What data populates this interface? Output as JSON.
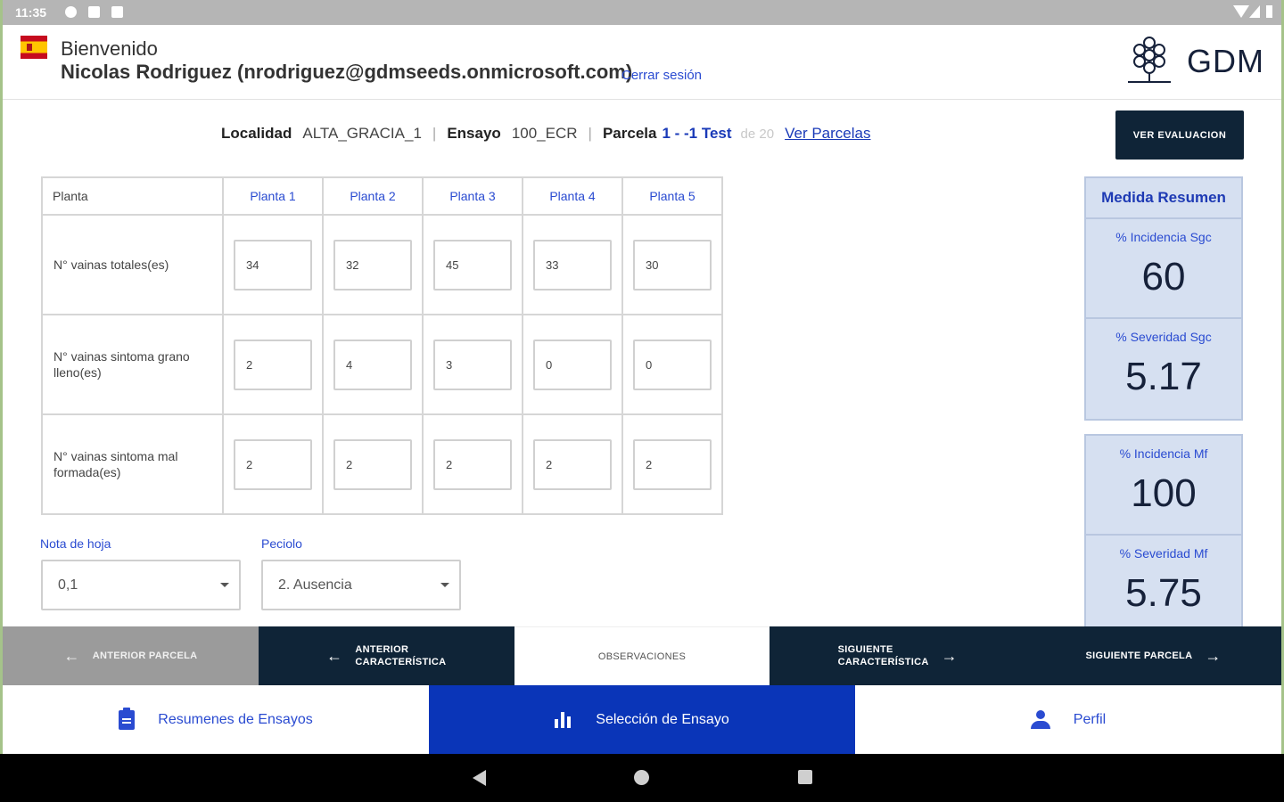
{
  "status_bar": {
    "time": "11:35"
  },
  "header": {
    "welcome": "Bienvenido",
    "user": "Nicolas Rodriguez (nrodriguez@gdmseeds.onmicrosoft.com)",
    "logout": "Cerrar sesión",
    "brand": "GDM"
  },
  "info": {
    "locality_label": "Localidad",
    "locality_value": "ALTA_GRACIA_1",
    "trial_label": "Ensayo",
    "trial_value": "100_ECR",
    "plot_label": "Parcela",
    "plot_value": "1 - -1 Test",
    "plot_total": "de 20",
    "plots_link": "Ver Parcelas",
    "eval_button": "VER EVALUACION"
  },
  "table": {
    "corner": "Planta",
    "columns": [
      "Planta 1",
      "Planta 2",
      "Planta 3",
      "Planta 4",
      "Planta 5"
    ],
    "rows": [
      {
        "label": "N° vainas totales(es)",
        "values": [
          "34",
          "32",
          "45",
          "33",
          "30"
        ]
      },
      {
        "label": "N° vainas sintoma grano lleno(es)",
        "values": [
          "2",
          "4",
          "3",
          "0",
          "0"
        ]
      },
      {
        "label": "N° vainas sintoma mal formada(es)",
        "values": [
          "2",
          "2",
          "2",
          "2",
          "2"
        ]
      }
    ]
  },
  "fields": {
    "leaf_label": "Nota de hoja",
    "leaf_value": "0,1",
    "petiole_label": "Peciolo",
    "petiole_value": "2. Ausencia"
  },
  "summary": {
    "title": "Medida Resumen",
    "items": [
      {
        "label": "% Incidencia Sgc",
        "value": "60"
      },
      {
        "label": "% Severidad Sgc",
        "value": "5.17"
      },
      {
        "label": "% Incidencia Mf",
        "value": "100"
      },
      {
        "label": "% Severidad Mf",
        "value": "5.75"
      }
    ]
  },
  "actions": {
    "prev_plot": "ANTERIOR PARCELA",
    "prev_char_1": "ANTERIOR",
    "prev_char_2": "CARACTERÍSTICA",
    "observations": "OBSERVACIONES",
    "next_char_1": "SIGUIENTE",
    "next_char_2": "CARACTERÍSTICA",
    "next_plot": "SIGUIENTE PARCELA"
  },
  "bottom_nav": {
    "summaries": "Resumenes de Ensayos",
    "selection": "Selección de Ensayo",
    "profile": "Perfil"
  },
  "colors": {
    "primary_dark": "#0f2437",
    "accent_blue": "#0a35b8",
    "summary_bg": "#d6e0f1",
    "disabled": "#9b9b9b"
  }
}
